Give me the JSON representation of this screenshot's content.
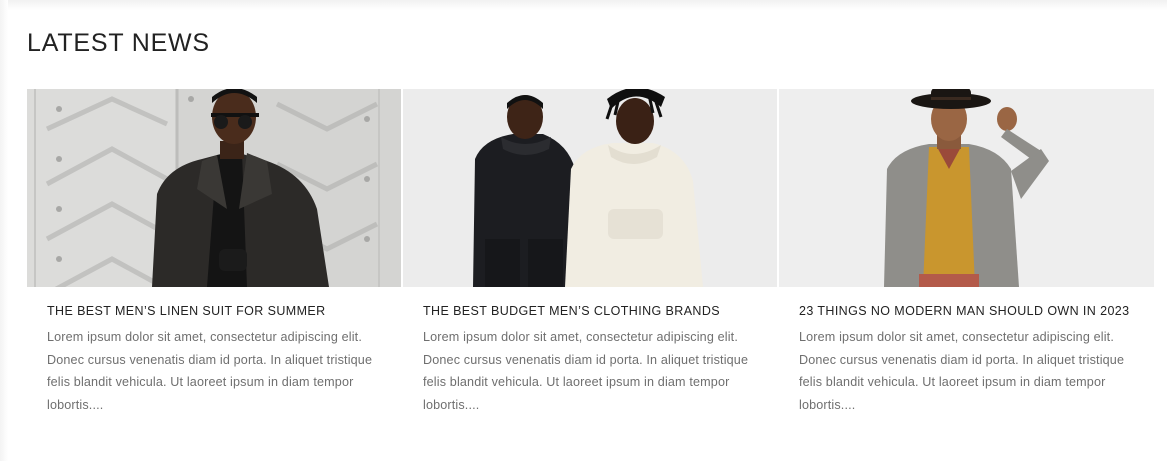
{
  "section": {
    "title": "LATEST NEWS"
  },
  "articles": [
    {
      "title": "THE BEST MEN’S LINEN SUIT FOR SUMMER",
      "excerpt": "Lorem ipsum dolor sit amet, consectetur adipiscing elit. Donec cursus venenatis diam id porta. In aliquet tristique felis blandit vehicula. Ut laoreet ipsum in diam tempor lobortis...."
    },
    {
      "title": "THE BEST BUDGET MEN’S CLOTHING BRANDS",
      "excerpt": "Lorem ipsum dolor sit amet, consectetur adipiscing elit. Donec cursus venenatis diam id porta. In aliquet tristique felis blandit vehicula. Ut laoreet ipsum in diam tempor lobortis...."
    },
    {
      "title": "23 THINGS NO MODERN MAN SHOULD OWN IN 2023",
      "excerpt": "Lorem ipsum dolor sit amet, consectetur adipiscing elit. Donec cursus venenatis diam id porta. In aliquet tristique felis blandit vehicula. Ut laoreet ipsum in diam tempor lobortis...."
    }
  ],
  "colors": {
    "heading": "#222222",
    "body_text": "#6f6f6f",
    "image_background": "#eeeeee"
  }
}
